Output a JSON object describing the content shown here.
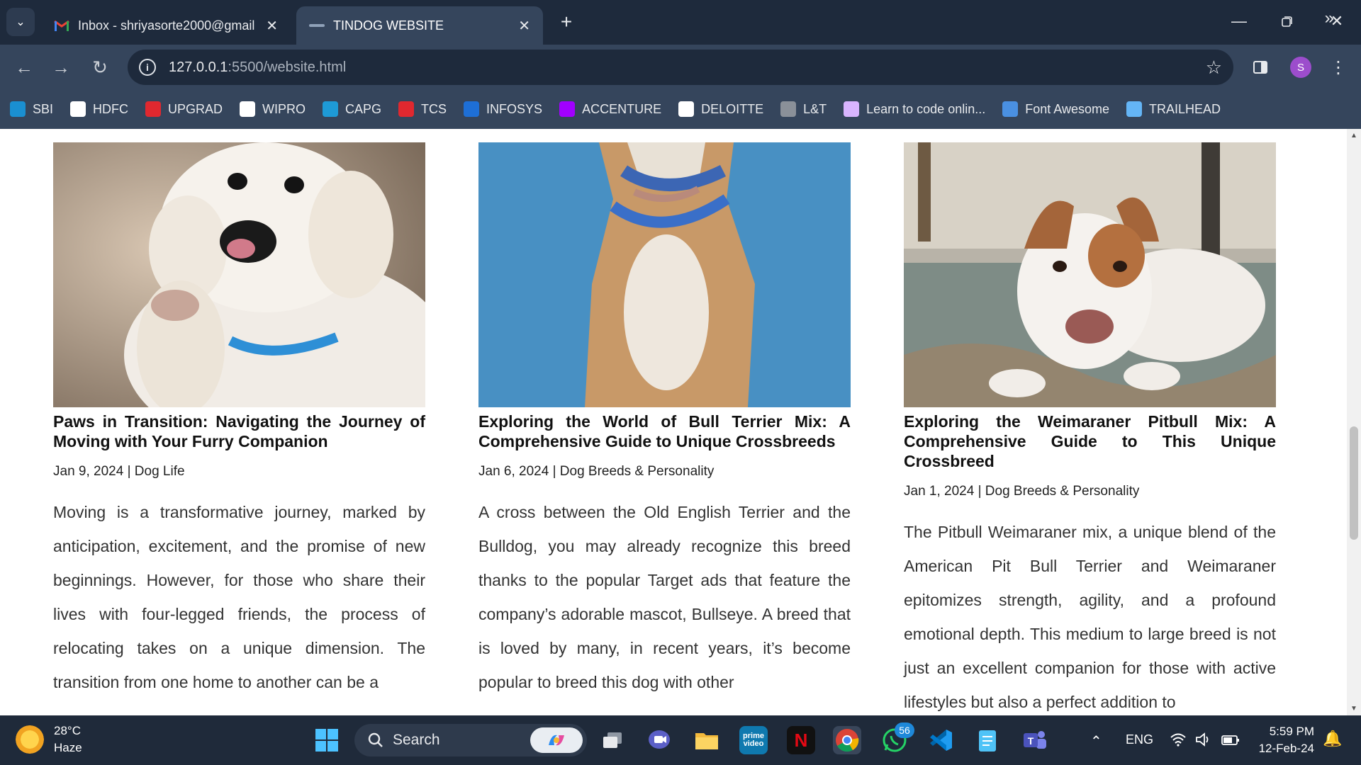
{
  "browser": {
    "tabs": [
      {
        "title": "Inbox - shriyasorte2000@gmail",
        "favicon": "gmail-icon",
        "active": false
      },
      {
        "title": "TINDOG WEBSITE",
        "favicon": "tindog-icon",
        "active": true
      }
    ],
    "url_host": "127.0.0.1",
    "url_path": ":5500/website.html",
    "profile_initial": "S",
    "bookmarks": [
      {
        "label": "SBI",
        "icon": "sbi-icon",
        "color": "#1a8fd1"
      },
      {
        "label": "HDFC",
        "icon": "hdfc-icon",
        "color": "#ffffff"
      },
      {
        "label": "UPGRAD",
        "icon": "upgrad-icon",
        "color": "#e0282f"
      },
      {
        "label": "WIPRO",
        "icon": "wipro-icon",
        "color": "#ffffff"
      },
      {
        "label": "CAPG",
        "icon": "capg-icon",
        "color": "#1e9ad6"
      },
      {
        "label": "TCS",
        "icon": "tcs-icon",
        "color": "#e0282f"
      },
      {
        "label": "INFOSYS",
        "icon": "infosys-icon",
        "color": "#1e6fd6"
      },
      {
        "label": "ACCENTURE",
        "icon": "accenture-icon",
        "color": "#a100ff"
      },
      {
        "label": "DELOITTE",
        "icon": "deloitte-icon",
        "color": "#ffffff"
      },
      {
        "label": "L&T",
        "icon": "lt-icon",
        "color": "#8a9099"
      },
      {
        "label": "Learn to code onlin...",
        "icon": "scrimba-icon",
        "color": "#d8b4fe"
      },
      {
        "label": "Font Awesome",
        "icon": "flag-icon",
        "color": "#4a90e2"
      },
      {
        "label": "TRAILHEAD",
        "icon": "trailhead-icon",
        "color": "#64b5f6"
      }
    ]
  },
  "posts": [
    {
      "title": "Paws in Transition: Navigating the Journey of Moving with Your Furry Companion",
      "meta": "Jan 9, 2024 | Dog Life",
      "excerpt": "Moving is a transformative journey, marked by anticipation, excitement, and the promise of new beginnings. However, for those who share their lives with four-legged friends, the process of relocating takes on a unique dimension. The transition from one home to another can be a"
    },
    {
      "title": "Exploring the World of Bull Terrier Mix: A Comprehensive Guide to Unique Crossbreeds",
      "meta": "Jan 6, 2024 | Dog Breeds & Personality",
      "excerpt": "A cross between the Old English Terrier and the Bulldog, you may already recognize this breed thanks to the popular Target ads that feature the company’s adorable mascot, Bullseye. A breed that is loved by many, in recent years, it’s become popular to breed this dog with other"
    },
    {
      "title": "Exploring the Weimaraner Pitbull Mix: A Comprehensive Guide to This Unique Crossbreed",
      "meta": "Jan 1, 2024 | Dog Breeds & Personality",
      "excerpt": "The Pitbull Weimaraner mix, a unique blend of the American Pit Bull Terrier and Weimaraner epitomizes strength, agility, and a profound emotional depth. This medium to large breed is not just an excellent companion for those with active lifestyles but also a perfect addition to"
    }
  ],
  "taskbar": {
    "temperature": "28°C",
    "condition": "Haze",
    "search_label": "Search",
    "whatsapp_badge": "56",
    "language": "ENG",
    "time": "5:59 PM",
    "date": "12-Feb-24"
  }
}
